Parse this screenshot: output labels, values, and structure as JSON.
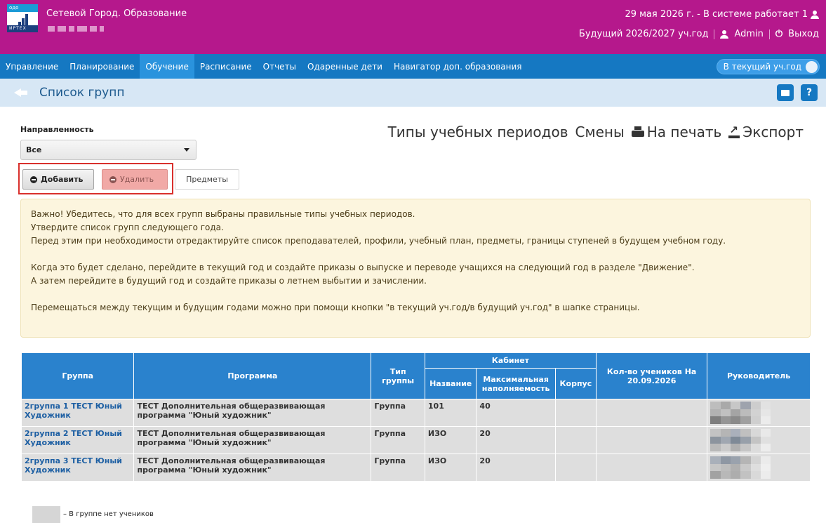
{
  "header": {
    "logo_top": "одо",
    "logo_bottom": "ИРТЕХ",
    "app_title": "Сетевой Город. Образование",
    "date_status": "29 мая 2026 г. - В системе работает 1",
    "year": "Будущий 2026/2027 уч.год",
    "user": "Admin",
    "logout": "Выход"
  },
  "nav": {
    "items": [
      {
        "label": "Управление",
        "active": false
      },
      {
        "label": "Планирование",
        "active": false
      },
      {
        "label": "Обучение",
        "active": true
      },
      {
        "label": "Расписание",
        "active": false
      },
      {
        "label": "Отчеты",
        "active": false
      },
      {
        "label": "Одаренные дети",
        "active": false
      },
      {
        "label": "Навигатор доп. образования",
        "active": false
      }
    ],
    "toggle_label": "В текущий уч.год"
  },
  "page": {
    "title": "Список групп",
    "mail_icon": "mail-icon",
    "help_label": "?"
  },
  "filter": {
    "label": "Направленность",
    "value": "Все"
  },
  "links": {
    "period_types": "Типы учебных периодов",
    "shifts": "Смены",
    "print": "На печать",
    "export": "Экспорт"
  },
  "buttons": {
    "add": "Добавить",
    "delete": "Удалить",
    "subjects": "Предметы"
  },
  "notice": {
    "lines": [
      "Важно! Убедитесь, что для всех групп выбраны правильные типы учебных периодов.",
      "Утвердите список групп следующего года.",
      "Перед этим при необходимости отредактируйте список преподавателей, профили, учебный план, предметы, границы ступеней в будущем учебном году.",
      "Когда это будет сделано, перейдите в текущий год и создайте приказы о выпуске и переводе учащихся на следующий год в разделе \"Движение\".",
      "А затем перейдите в будущий год и создайте приказы о летнем выбытии и зачислении.",
      "Перемещаться между текущим и будущим годами можно при помощи кнопки \"в текущий уч.год/в будущий уч.год\" в шапке страницы."
    ]
  },
  "table": {
    "headers": {
      "group": "Группа",
      "program": "Программа",
      "type": "Тип группы",
      "cabinet": "Кабинет",
      "cab_name": "Название",
      "cab_capacity": "Максимальная наполняемость",
      "cab_building": "Корпус",
      "students": "Кол-во учеников На 20.09.2026",
      "leader": "Руководитель"
    },
    "rows": [
      {
        "group": "2группа 1 ТЕСТ Юный Художник",
        "program": "ТЕСТ Дополнительная общеразвивающая программа \"Юный художник\"",
        "type": "Группа",
        "cab_name": "101",
        "cab_capacity": "40",
        "cab_building": "",
        "students": ""
      },
      {
        "group": "2группа 2 ТЕСТ Юный Художник",
        "program": "ТЕСТ Дополнительная общеразвивающая программа \"Юный художник\"",
        "type": "Группа",
        "cab_name": "ИЗО",
        "cab_capacity": "20",
        "cab_building": "",
        "students": ""
      },
      {
        "group": "2группа 3 ТЕСТ Юный Художник",
        "program": "ТЕСТ Дополнительная общеразвивающая программа \"Юный художник\"",
        "type": "Группа",
        "cab_name": "ИЗО",
        "cab_capacity": "20",
        "cab_building": "",
        "students": ""
      }
    ]
  },
  "legend": {
    "text": "– В группе нет учеников"
  },
  "colors": {
    "header_bg": "#b5188c",
    "nav_bg": "#1578c2",
    "table_header": "#2a82cd",
    "delete_button": "#f1a9a6",
    "notice_bg": "#fcf5de"
  }
}
